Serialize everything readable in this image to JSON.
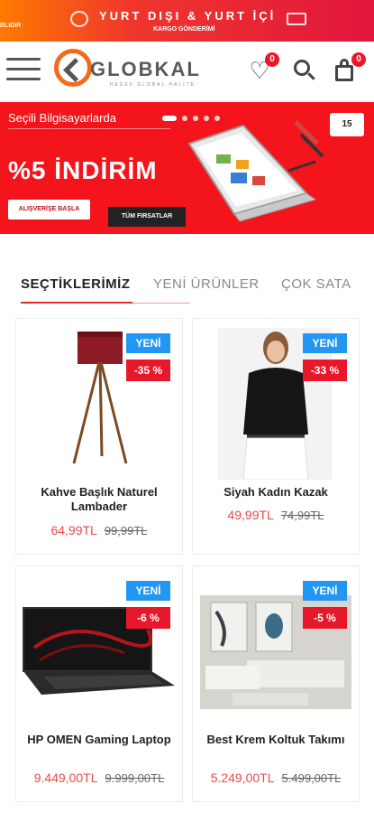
{
  "promo": {
    "left_text": "BLIDIR",
    "main": "YURT DIŞI & YURT İÇİ",
    "sub": "KARGO GÖNDERİMİ"
  },
  "header": {
    "logo_name": "GLOBKAL",
    "logo_tagline": "HEDEF GLOBAL HALİTE",
    "wishlist_count": "0",
    "cart_count": "0"
  },
  "hero": {
    "kicker": "Seçili Bilgisayarlarda",
    "headline": "%5 İNDİRİM",
    "cta_primary": "ALIŞVERİŞE BAŞLA",
    "cta_secondary": "TÜM FIRSATLAR",
    "stamp": "15"
  },
  "tabs": [
    {
      "label": "SEÇTİKLERİMİZ",
      "active": true
    },
    {
      "label": "YENİ ÜRÜNLER",
      "active": false
    },
    {
      "label": "ÇOK SATA",
      "active": false
    }
  ],
  "products": [
    {
      "title": "Kahve Başlık Naturel Lambader",
      "badge_new": "YENİ",
      "discount": "-35 %",
      "price": "64,99TL",
      "old_price": "99,99TL"
    },
    {
      "title": "Siyah Kadın Kazak",
      "badge_new": "YENİ",
      "discount": "-33 %",
      "price": "49,99TL",
      "old_price": "74,99TL"
    },
    {
      "title": "HP OMEN Gaming Laptop",
      "badge_new": "YENİ",
      "discount": "-6 %",
      "price": "9.449,00TL",
      "old_price": "9.999,00TL"
    },
    {
      "title": "Best Krem Koltuk Takımı",
      "badge_new": "YENİ",
      "discount": "-5 %",
      "price": "5.249,00TL",
      "old_price": "5.499,00TL"
    }
  ],
  "colors": {
    "accent": "#e8182b",
    "new_badge": "#2196f3",
    "logo_orange": "#f26b1d"
  }
}
